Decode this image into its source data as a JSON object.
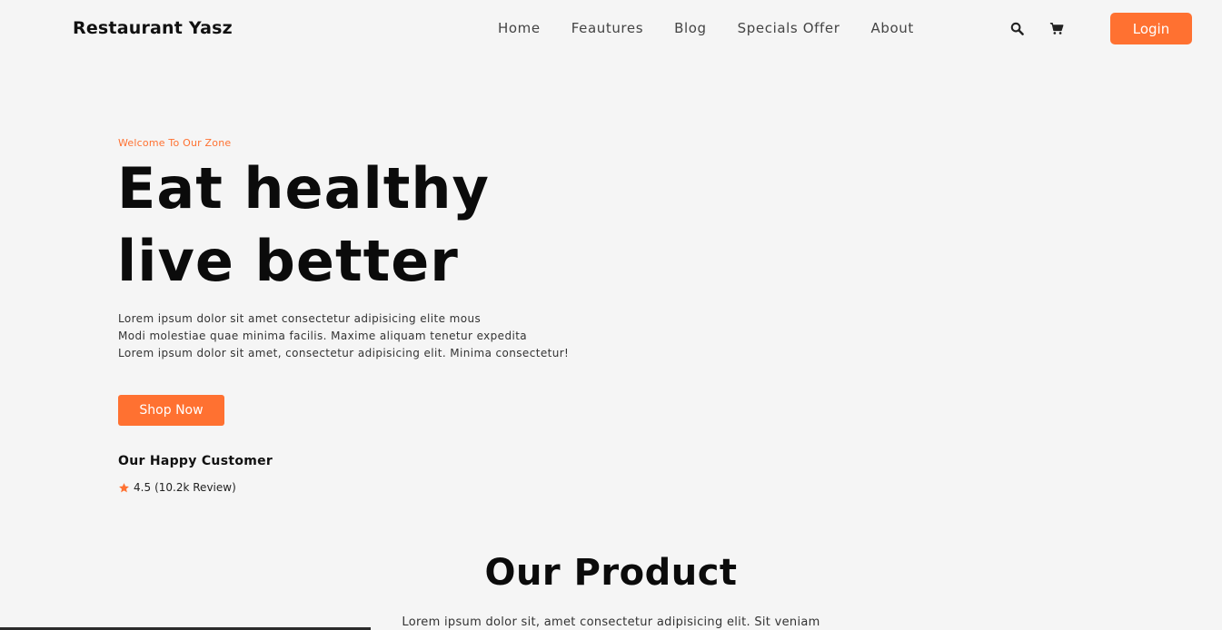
{
  "header": {
    "brand": "Restaurant Yasz",
    "nav": [
      "Home",
      "Feautures",
      "Blog",
      "Specials Offer",
      "About"
    ],
    "search_icon": "search-icon",
    "cart_icon": "cart-icon",
    "login_label": "Login"
  },
  "hero": {
    "eyebrow": "Welcome To Our Zone",
    "title_line1": "Eat healthy",
    "title_line2": "live better",
    "desc_line1": "Lorem ipsum dolor sit amet consectetur adipisicing elite mous",
    "desc_line2": "Modi molestiae quae minima facilis. Maxime aliquam tenetur expedita",
    "desc_line3": "Lorem ipsum dolor sit amet, consectetur adipisicing elit. Minima consectetur!",
    "shop_label": "Shop Now",
    "customer_title": "Our Happy Customer",
    "rating_icon": "star-icon",
    "rating_value": "4.5",
    "rating_reviews": "(10.2k Review)"
  },
  "products": {
    "title": "Our Product",
    "desc": "Lorem ipsum dolor sit, amet consectetur adipisicing elit. Sit veniam"
  },
  "colors": {
    "accent": "#ff7131",
    "background": "#f5f5f5",
    "text": "#111111"
  }
}
